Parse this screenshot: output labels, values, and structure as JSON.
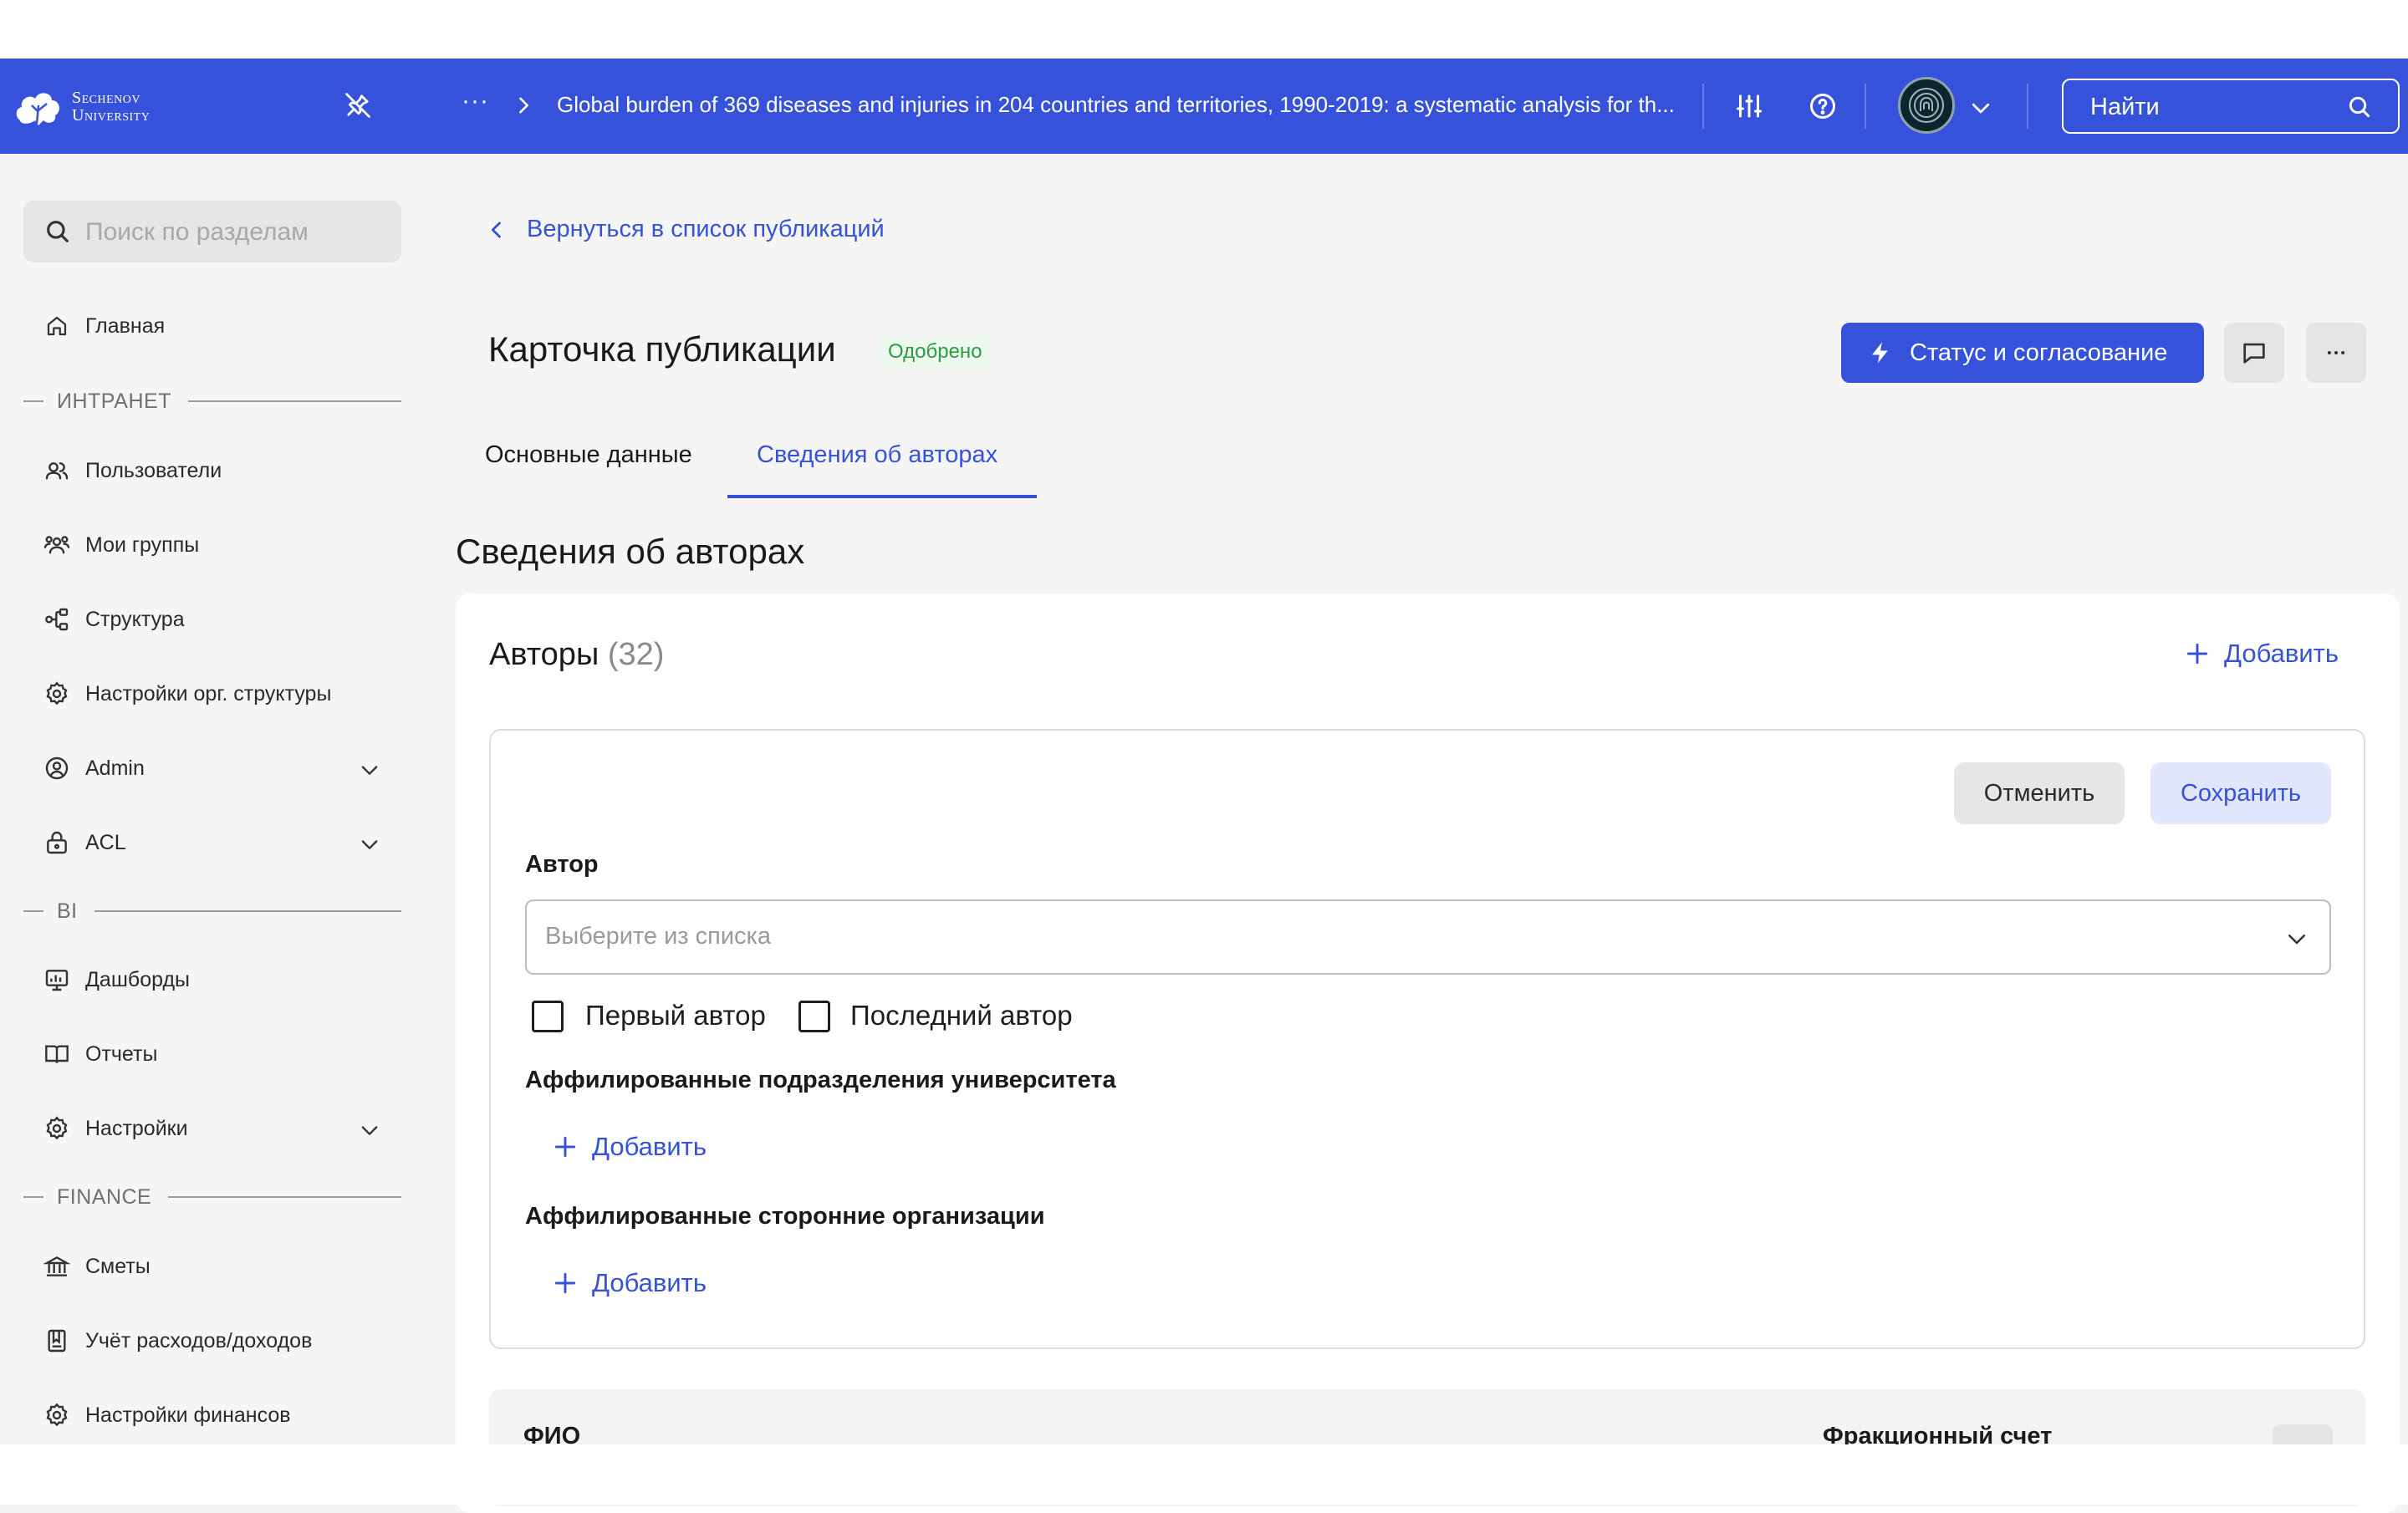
{
  "colors": {
    "brand": "#3652da",
    "status_green": "#2b9c3f",
    "background": "#f5f5f5"
  },
  "navbar": {
    "logo_line1": "Sechenov",
    "logo_line2": "University",
    "breadcrumb_overflow": "···",
    "breadcrumb_title": "Global burden of 369 diseases and injuries in 204 countries and territories, 1990-2019: a systematic analysis for th...",
    "search_placeholder": "Найти",
    "icons": [
      "logo-icon",
      "pin-off-icon",
      "chevron-right-icon",
      "sliders-icon",
      "help-icon",
      "avatar",
      "chevron-down-icon",
      "search-icon"
    ]
  },
  "sidebar": {
    "search_placeholder": "Поиск по разделам",
    "home": "Главная",
    "sections": {
      "intranet": "ИНТРАНЕТ",
      "bi": "BI",
      "finance": "FINANCE"
    },
    "items": {
      "users": "Пользователи",
      "groups": "Мои группы",
      "structure": "Структура",
      "org_settings": "Настройки орг. структуры",
      "admin": "Admin",
      "acl": "ACL",
      "dashboards": "Дашборды",
      "reports": "Отчеты",
      "settings": "Настройки",
      "estimates": "Сметы",
      "accounting": "Учёт расходов/доходов",
      "finance_settings": "Настройки финансов"
    }
  },
  "main": {
    "back_link": "Вернуться в список публикаций",
    "page_title": "Карточка публикации",
    "status_badge": "Одобрено",
    "status_button": "Статус и согласование",
    "tabs": {
      "main": "Основные данные",
      "authors": "Сведения об авторах"
    },
    "section_title": "Сведения об авторах",
    "authors_label": "Авторы",
    "authors_count": "(32)",
    "add_label": "Добавить",
    "form": {
      "cancel": "Отменить",
      "save": "Сохранить",
      "author_label": "Автор",
      "author_placeholder": "Выберите из списка",
      "first_author": "Первый автор",
      "last_author": "Последний автор",
      "first_author_checked": false,
      "last_author_checked": false,
      "affiliated_units_label": "Аффилированные подразделения университета",
      "affiliated_orgs_label": "Аффилированные сторонние организации",
      "add_label": "Добавить"
    },
    "table": {
      "col_fio": "ФИО",
      "col_fraction": "Фракционный счет"
    }
  }
}
